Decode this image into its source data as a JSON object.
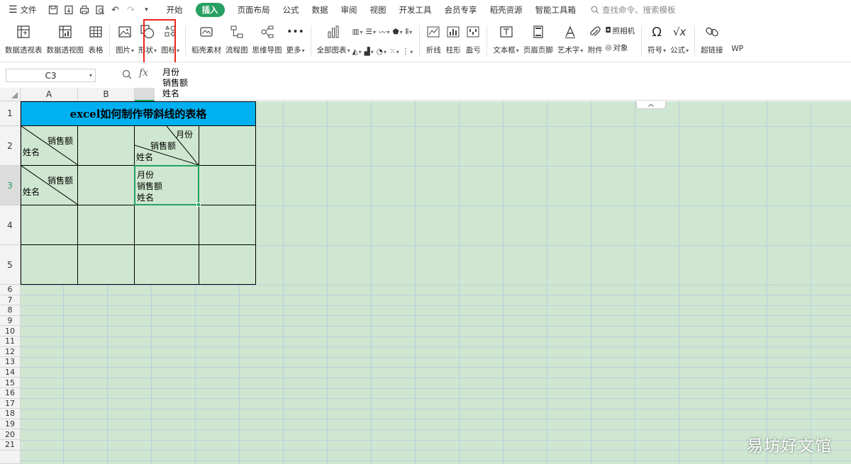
{
  "menubar": {
    "file_label": "文件",
    "tabs": [
      {
        "label": "开始",
        "active": false
      },
      {
        "label": "插入",
        "active": true
      },
      {
        "label": "页面布局",
        "active": false
      },
      {
        "label": "公式",
        "active": false
      },
      {
        "label": "数据",
        "active": false
      },
      {
        "label": "审阅",
        "active": false
      },
      {
        "label": "视图",
        "active": false
      },
      {
        "label": "开发工具",
        "active": false
      },
      {
        "label": "会员专享",
        "active": false
      },
      {
        "label": "稻壳资源",
        "active": false
      },
      {
        "label": "智能工具箱",
        "active": false
      }
    ],
    "search_placeholder": "查找命令、搜索模板"
  },
  "ribbon": {
    "pivot_table": "数据透视表",
    "pivot_chart": "数据透视图",
    "table": "表格",
    "picture": "图片",
    "shape": "形状",
    "icon": "图标",
    "docer_material": "稻壳素材",
    "flowchart": "流程图",
    "mindmap": "思维导图",
    "more": "更多",
    "all_charts": "全部图表",
    "line_spark": "折线",
    "column_spark": "柱形",
    "winloss": "盈亏",
    "textbox": "文本框",
    "header_footer": "页眉页脚",
    "wordart": "艺术字",
    "attachment": "附件",
    "camera": "照相机",
    "object": "对象",
    "symbol": "符号",
    "formula": "公式",
    "hyperlink": "超链接",
    "wp": "WP"
  },
  "formulabar": {
    "namebox": "C3",
    "fx": "fx",
    "content_lines": [
      "月份",
      "销售额",
      "姓名"
    ]
  },
  "columns": [
    "A",
    "B"
  ],
  "rows": [
    "1",
    "2",
    "3",
    "4",
    "5",
    "6",
    "7",
    "8",
    "9",
    "10",
    "11",
    "12",
    "13",
    "14",
    "15",
    "16",
    "17",
    "18",
    "19",
    "20",
    "21"
  ],
  "table": {
    "title": "excel如何制作带斜线的表格",
    "a2": {
      "top": "销售额",
      "bottom": "姓名"
    },
    "a3": {
      "top": "销售额",
      "bottom": "姓名"
    },
    "c2": {
      "top": "月份",
      "middle": "销售额",
      "bottom": "姓名"
    },
    "c3": {
      "line1": "月份",
      "line2": "销售额",
      "line3": "姓名"
    }
  },
  "watermark": "易坊好文馆",
  "colors": {
    "accent_green": "#27a061",
    "title_fill": "#00b0f0",
    "sheet_bg": "#cfe7d0",
    "highlight_red": "#e8261e"
  }
}
